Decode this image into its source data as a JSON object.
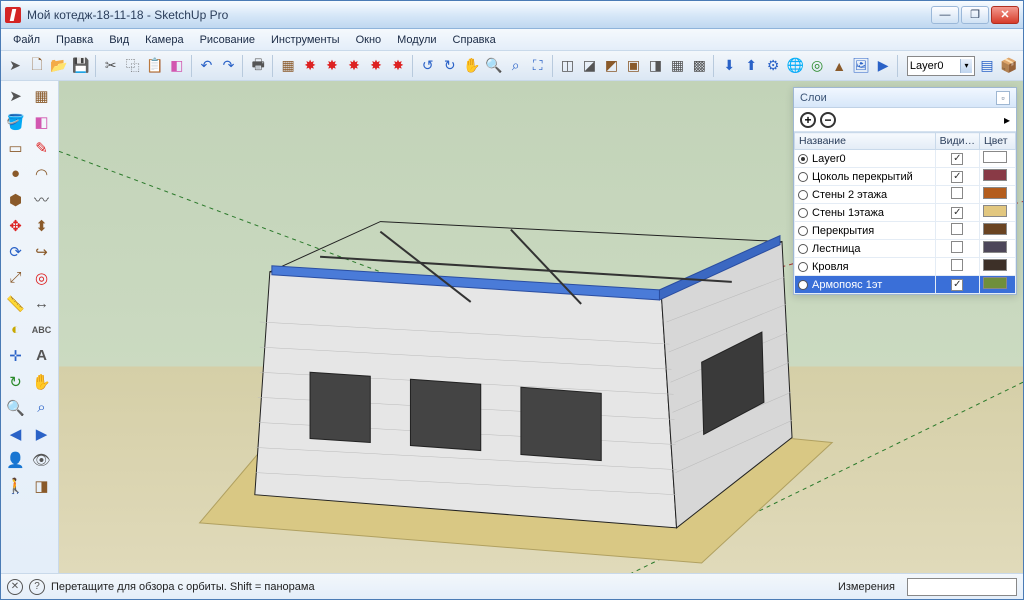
{
  "window": {
    "title": "Мой котедж-18-11-18 - SketchUp Pro"
  },
  "menu": {
    "items": [
      "Файл",
      "Правка",
      "Вид",
      "Камера",
      "Рисование",
      "Инструменты",
      "Окно",
      "Модули",
      "Справка"
    ]
  },
  "toolbar": {
    "layer_selected": "Layer0"
  },
  "layers_panel": {
    "title": "Слои",
    "add_symbol": "+",
    "remove_symbol": "−",
    "headers": {
      "name": "Название",
      "visible": "Види…",
      "color": "Цвет"
    },
    "rows": [
      {
        "name": "Layer0",
        "active": true,
        "visible": true,
        "color": "#ffffff"
      },
      {
        "name": "Цоколь перекрытий",
        "active": false,
        "visible": true,
        "color": "#893a46"
      },
      {
        "name": "Стены 2 этажа",
        "active": false,
        "visible": false,
        "color": "#b45d1c"
      },
      {
        "name": "Стены 1этажа",
        "active": false,
        "visible": true,
        "color": "#e2c77f"
      },
      {
        "name": "Перекрытия",
        "active": false,
        "visible": false,
        "color": "#6a4422"
      },
      {
        "name": "Лестница",
        "active": false,
        "visible": false,
        "color": "#4d4659"
      },
      {
        "name": "Кровля",
        "active": false,
        "visible": false,
        "color": "#3d3028"
      },
      {
        "name": "Армопояс 1эт",
        "active": false,
        "visible": true,
        "color": "#6f8f3c",
        "selected": true
      }
    ]
  },
  "status": {
    "hint": "Перетащите для обзора с орбиты.  Shift = панорама",
    "measure_label": "Измерения"
  }
}
